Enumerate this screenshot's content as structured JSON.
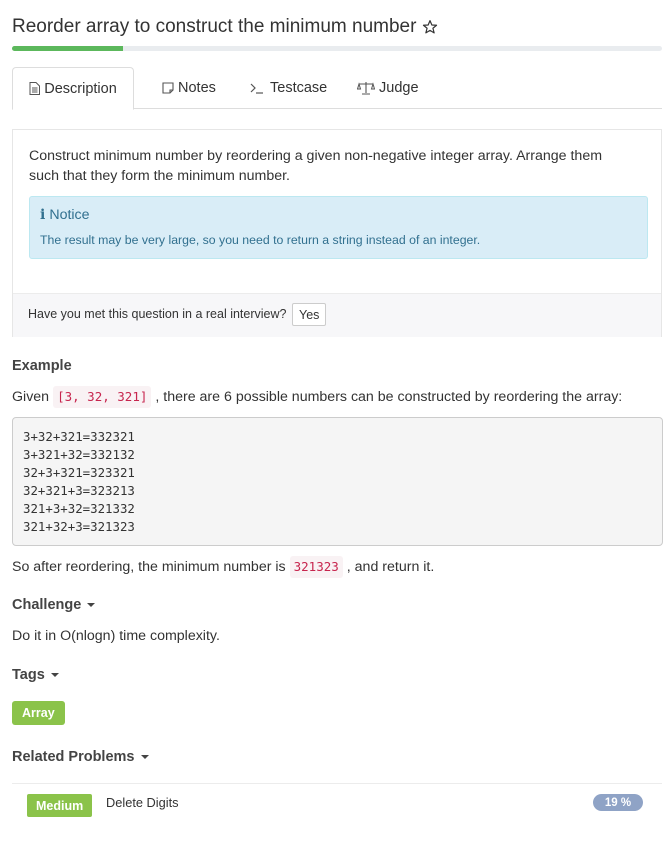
{
  "problem": {
    "title": "Reorder array to construct the minimum number",
    "progress_fraction": 0.17
  },
  "tabs": [
    {
      "label": "Description",
      "icon": "document-icon"
    },
    {
      "label": "Notes",
      "icon": "note-icon"
    },
    {
      "label": "Testcase",
      "icon": "terminal-icon"
    },
    {
      "label": "Judge",
      "icon": "scale-icon"
    }
  ],
  "description": {
    "line1": "Construct minimum number by reordering a given non-negative integer array. Arrange them",
    "line2": "such that they form the minimum number.",
    "notice_title": "Notice",
    "notice_body": "The result may be very large, so you need to return a string instead of an integer.",
    "interview_question": "Have you met this question in a real interview?",
    "yes_label": "Yes"
  },
  "example": {
    "heading": "Example",
    "intro_prefix": "Given",
    "intro_code": "[3, 32, 321]",
    "intro_suffix": ", there are 6 possible numbers can be constructed by reordering the array:",
    "lines": [
      "3+32+321=332321",
      "3+321+32=332132",
      "32+3+321=323321",
      "32+321+3=323213",
      "321+3+32=321332",
      "321+32+3=321323"
    ],
    "result_prefix": "So after reordering, the minimum number is",
    "result_code": "321323",
    "result_suffix": ", and return it."
  },
  "challenge": {
    "heading": "Challenge",
    "text": "Do it in O(nlogn) time complexity."
  },
  "tags": {
    "heading": "Tags",
    "items": [
      "Array"
    ]
  },
  "related": {
    "heading": "Related Problems",
    "items": [
      {
        "level": "Medium",
        "name": "Delete Digits",
        "rate": "19 %"
      }
    ]
  },
  "colors": {
    "accent_green": "#8bc34a",
    "progress_green": "#5cb85c",
    "notice_bg": "#d9edf7",
    "notice_text": "#31708f",
    "code_red": "#c7254e",
    "rate_badge": "#8fa3c6"
  }
}
